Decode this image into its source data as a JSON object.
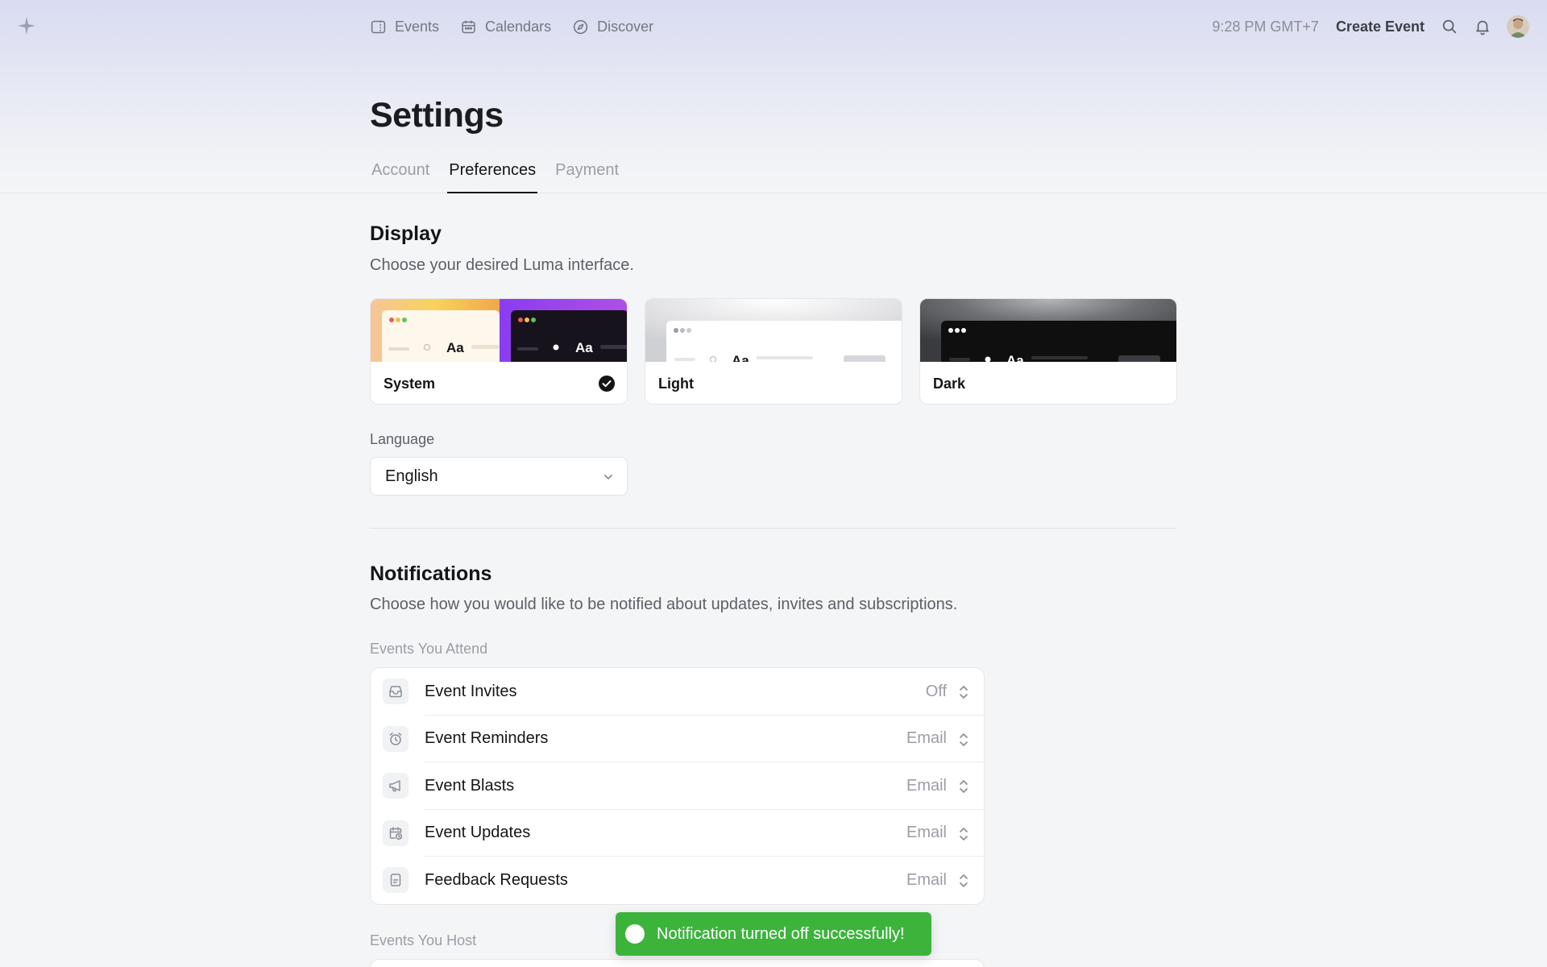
{
  "nav": {
    "links": [
      {
        "label": "Events",
        "icon": "ticket-icon"
      },
      {
        "label": "Calendars",
        "icon": "calendar-icon"
      },
      {
        "label": "Discover",
        "icon": "compass-icon"
      }
    ],
    "time": "9:28 PM GMT+7",
    "create_event": "Create Event"
  },
  "page": {
    "title": "Settings",
    "tabs": [
      "Account",
      "Preferences",
      "Payment"
    ],
    "active_tab": "Preferences"
  },
  "display": {
    "title": "Display",
    "description": "Choose your desired Luma interface.",
    "themes": [
      {
        "label": "System",
        "selected": true,
        "preview_text": "Aa"
      },
      {
        "label": "Light",
        "selected": false,
        "preview_text": "Aa"
      },
      {
        "label": "Dark",
        "selected": false,
        "preview_text": "Aa"
      }
    ]
  },
  "language": {
    "label": "Language",
    "value": "English"
  },
  "notifications": {
    "title": "Notifications",
    "description": "Choose how you would like to be notified about updates, invites and subscriptions.",
    "attend_label": "Events You Attend",
    "attend_items": [
      {
        "label": "Event Invites",
        "value": "Off",
        "icon": "inbox-icon"
      },
      {
        "label": "Event Reminders",
        "value": "Email",
        "icon": "alarm-clock-icon"
      },
      {
        "label": "Event Blasts",
        "value": "Email",
        "icon": "megaphone-icon"
      },
      {
        "label": "Event Updates",
        "value": "Email",
        "icon": "calendar-clock-icon"
      },
      {
        "label": "Feedback Requests",
        "value": "Email",
        "icon": "document-icon"
      }
    ],
    "host_label": "Events You Host"
  },
  "toast": {
    "message": "Notification turned off successfully!",
    "color": "#3cb43c"
  },
  "colors": {
    "text": "#131517",
    "muted": "#9a9ea6",
    "toast": "#3cb43c"
  }
}
